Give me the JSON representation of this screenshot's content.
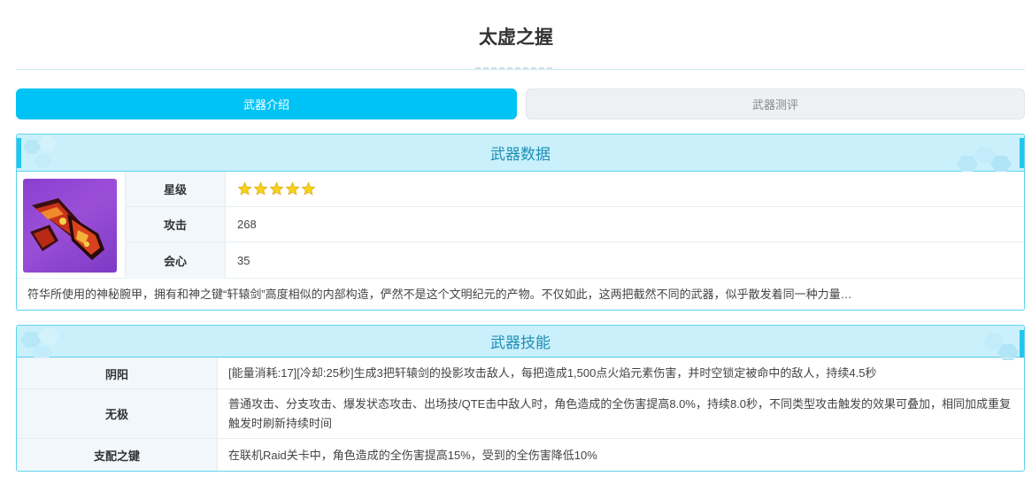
{
  "page": {
    "title": "太虚之握"
  },
  "tabs": [
    {
      "label": "武器介绍",
      "active": true
    },
    {
      "label": "武器测评",
      "active": false
    }
  ],
  "weapon_data": {
    "header": "武器数据",
    "rows": [
      {
        "label": "星级",
        "value": "",
        "stars": 5
      },
      {
        "label": "攻击",
        "value": "268"
      },
      {
        "label": "会心",
        "value": "35"
      }
    ],
    "description": "符华所使用的神秘腕甲，拥有和神之键“轩辕剑”高度相似的内部构造，俨然不是这个文明纪元的产物。不仅如此，这两把截然不同的武器，似乎散发着同一种力量…"
  },
  "weapon_skills": {
    "header": "武器技能",
    "rows": [
      {
        "label": "阴阳",
        "value": "[能量消耗:17][冷却:25秒]生成3把轩辕剑的投影攻击敌人，每把造成1,500点火焰元素伤害，并时空锁定被命中的敌人，持续4.5秒"
      },
      {
        "label": "无极",
        "value": "普通攻击、分支攻击、爆发状态攻击、出场技/QTE击中敌人时，角色造成的全伤害提高8.0%，持续8.0秒，不同类型攻击触发的效果可叠加，相同加成重复触发时刷新持续时间"
      },
      {
        "label": "支配之键",
        "value": "在联机Raid关卡中，角色造成的全伤害提高15%，受到的全伤害降低10%"
      }
    ]
  },
  "colors": {
    "accent": "#00c3f5",
    "panel_header_bg": "#caf0fc",
    "panel_header_text": "#1f8fb5",
    "panel_border": "#5fd3ee",
    "label_bg": "#f1f7fb",
    "star": "#f7d21a"
  },
  "icons": {
    "star": "star-icon",
    "weapon": "weapon-gauntlet-image"
  }
}
